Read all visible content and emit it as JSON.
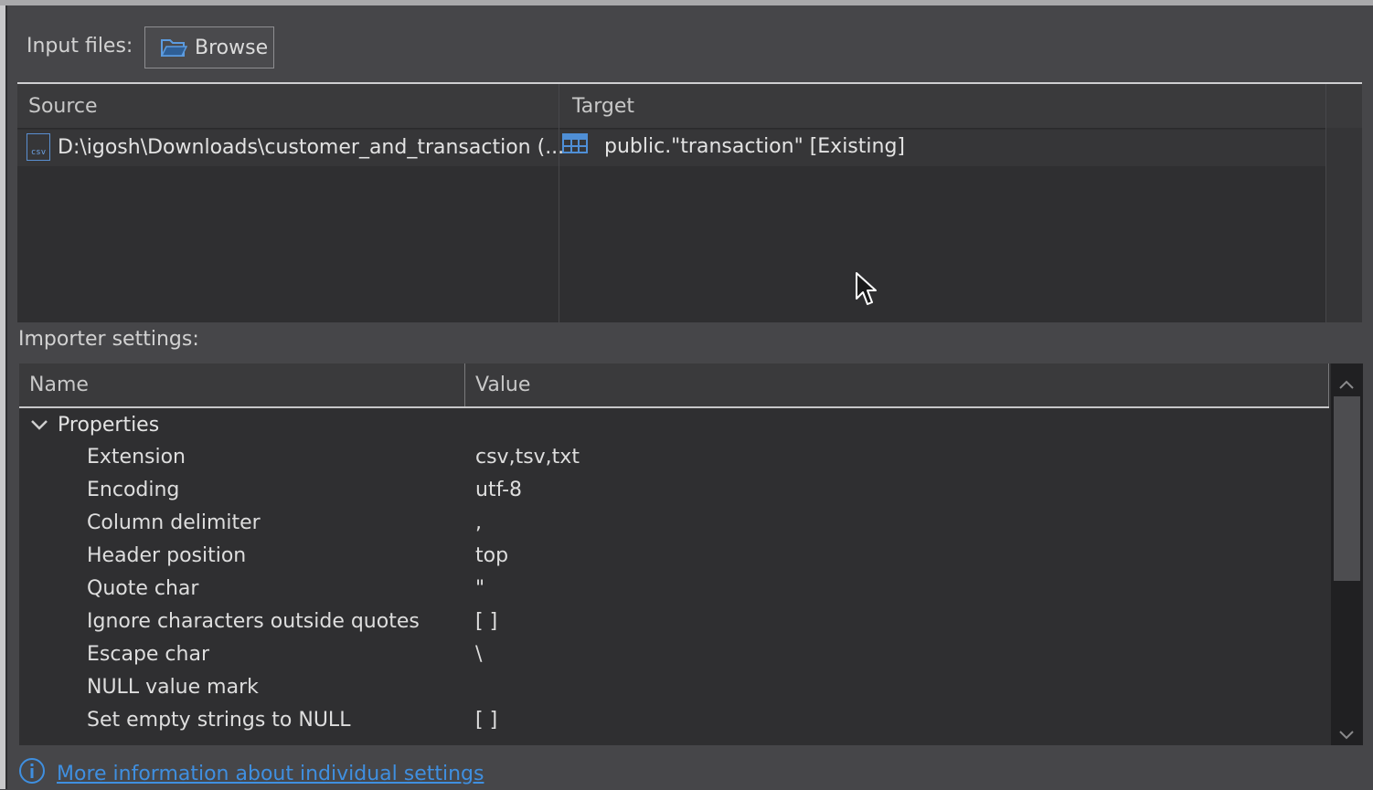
{
  "input": {
    "label": "Input files:",
    "browse_label": "Browse"
  },
  "files_table": {
    "columns": [
      "Source",
      "Target"
    ],
    "rows": [
      {
        "source": "D:\\igosh\\Downloads\\customer_and_transaction (...",
        "target": "public.\"transaction\" [Existing]"
      }
    ]
  },
  "settings": {
    "label": "Importer settings:",
    "columns": [
      "Name",
      "Value"
    ],
    "group": "Properties",
    "properties": [
      {
        "name": "Extension",
        "value": "csv,tsv,txt"
      },
      {
        "name": "Encoding",
        "value": "utf-8"
      },
      {
        "name": "Column delimiter",
        "value": ","
      },
      {
        "name": "Header position",
        "value": "top"
      },
      {
        "name": "Quote char",
        "value": "\""
      },
      {
        "name": "Ignore characters outside quotes",
        "value": "[ ]"
      },
      {
        "name": "Escape char",
        "value": "\\"
      },
      {
        "name": "NULL value mark",
        "value": ""
      },
      {
        "name": "Set empty strings to NULL",
        "value": "[ ]"
      }
    ]
  },
  "footer": {
    "link_label": "More information about individual settings"
  },
  "colors": {
    "accent": "#3f8fe0",
    "background": "#464649",
    "table_bg": "#2f2f31"
  },
  "icons": {
    "browse": "folder-open-icon",
    "source": "csv-file-icon",
    "target": "table-icon",
    "info": "info-icon"
  }
}
